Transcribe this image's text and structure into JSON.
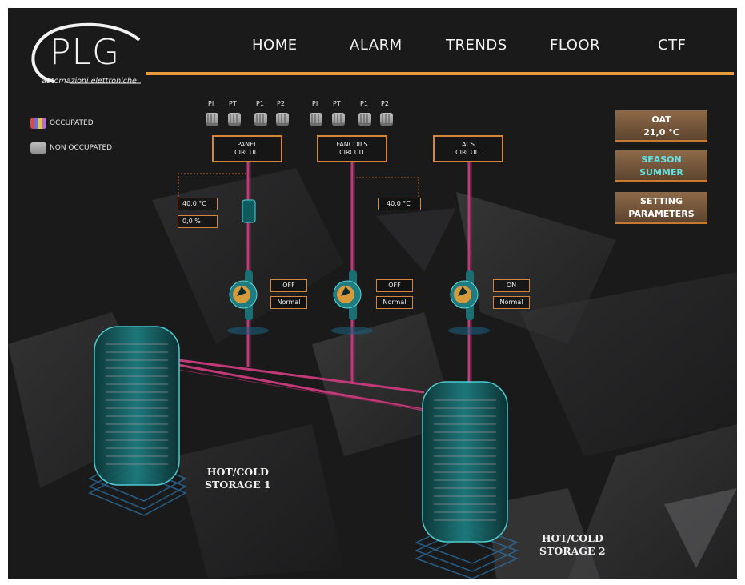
{
  "logo": {
    "name": "PLG",
    "tagline": "automazioni elettroniche"
  },
  "nav": {
    "items": [
      "HOME",
      "ALARM",
      "TRENDS",
      "FLOOR",
      "CTF"
    ]
  },
  "legend": {
    "occupied": "OCCUPATED",
    "non_occupied": "NON OCCUPATED"
  },
  "zones": {
    "labels": [
      "PI",
      "PT",
      "P1",
      "P2"
    ]
  },
  "circuits": {
    "panel": {
      "line1": "PANEL",
      "line2": "CIRCUIT"
    },
    "fancoils": {
      "line1": "FANCOILS",
      "line2": "CIRCUIT"
    },
    "acs": {
      "line1": "ACS",
      "line2": "CIRCUIT"
    }
  },
  "panel_readings": {
    "temperature": "40,0 °C",
    "valve": "0,0 %"
  },
  "fancoils_readings": {
    "temperature": "40,0 °C"
  },
  "pumps": {
    "panel": {
      "state": "OFF",
      "mode": "Normal"
    },
    "fancoils": {
      "state": "OFF",
      "mode": "Normal"
    },
    "acs": {
      "state": "ON",
      "mode": "Normal"
    }
  },
  "side_panel": {
    "oat_label": "OAT",
    "oat_value": "21,0 °C",
    "season_label": "SEASON",
    "season_value": "SUMMER",
    "settings_line1": "SETTING",
    "settings_line2": "PARAMETERS"
  },
  "storage": {
    "tank1_line1": "HOT/COLD",
    "tank1_line2": "STORAGE 1",
    "tank2_line1": "HOT/COLD",
    "tank2_line2": "STORAGE 2"
  },
  "colors": {
    "accent": "#e89a3c",
    "pipe": "#c2397a",
    "tank": "#3fd0d6",
    "season_text": "#63e3e6"
  }
}
